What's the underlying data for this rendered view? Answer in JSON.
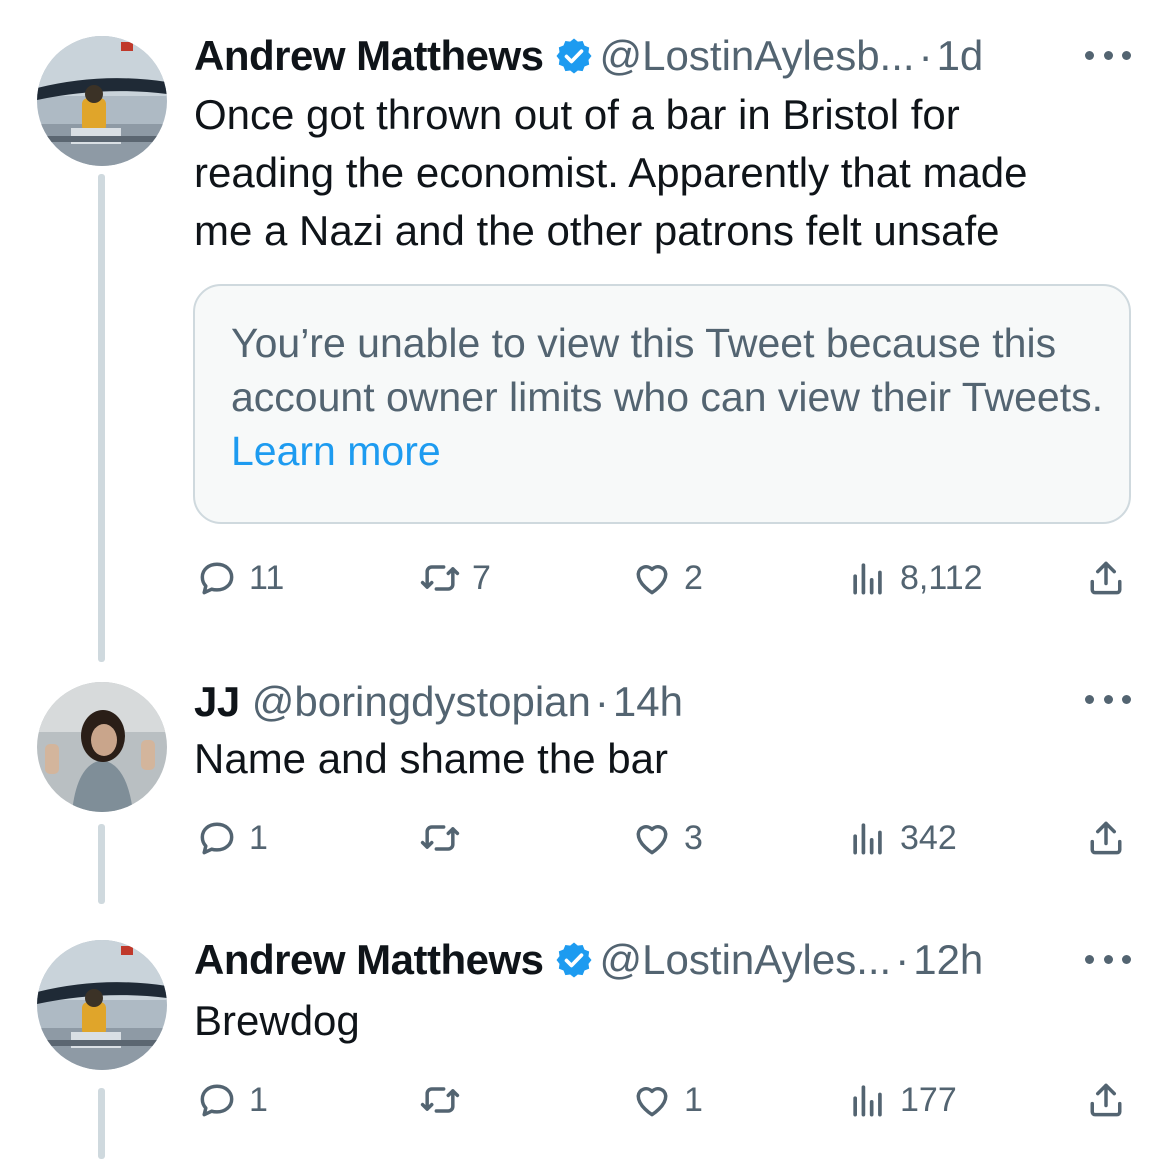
{
  "tweets": [
    {
      "name": "Andrew Matthews",
      "handle": "@LostinAylesb...",
      "dot": "·",
      "time": "1d",
      "text_lines": [
        "Once got thrown out of a bar in Bristol for",
        "reading the economist. Apparently that made",
        "me a Nazi and the other patrons felt unsafe"
      ],
      "quote": {
        "text": "You’re unable to view this Tweet because this account owner limits who can view their Tweets.",
        "link": "Learn more"
      },
      "replies": "11",
      "retweets": "7",
      "likes": "2",
      "views": "8,112"
    },
    {
      "name": "JJ",
      "handle": "@boringdystopian",
      "dot": "·",
      "time": "14h",
      "text_lines": [
        "Name and shame the bar"
      ],
      "replies": "1",
      "retweets": "",
      "likes": "3",
      "views": "342"
    },
    {
      "name": "Andrew Matthews",
      "handle": "@LostinAyles...",
      "dot": "·",
      "time": "12h",
      "text_lines": [
        "Brewdog"
      ],
      "replies": "1",
      "retweets": "",
      "likes": "1",
      "views": "177"
    }
  ],
  "icons": {
    "verified": "verified-badge-icon",
    "reply": "reply-icon",
    "retweet": "retweet-icon",
    "like": "heart-icon",
    "views": "views-icon",
    "share": "share-icon",
    "more": "more-icon"
  },
  "colors": {
    "accent": "#1d9bf0",
    "secondary_text": "#536471",
    "thread_line": "#cfd9de"
  }
}
